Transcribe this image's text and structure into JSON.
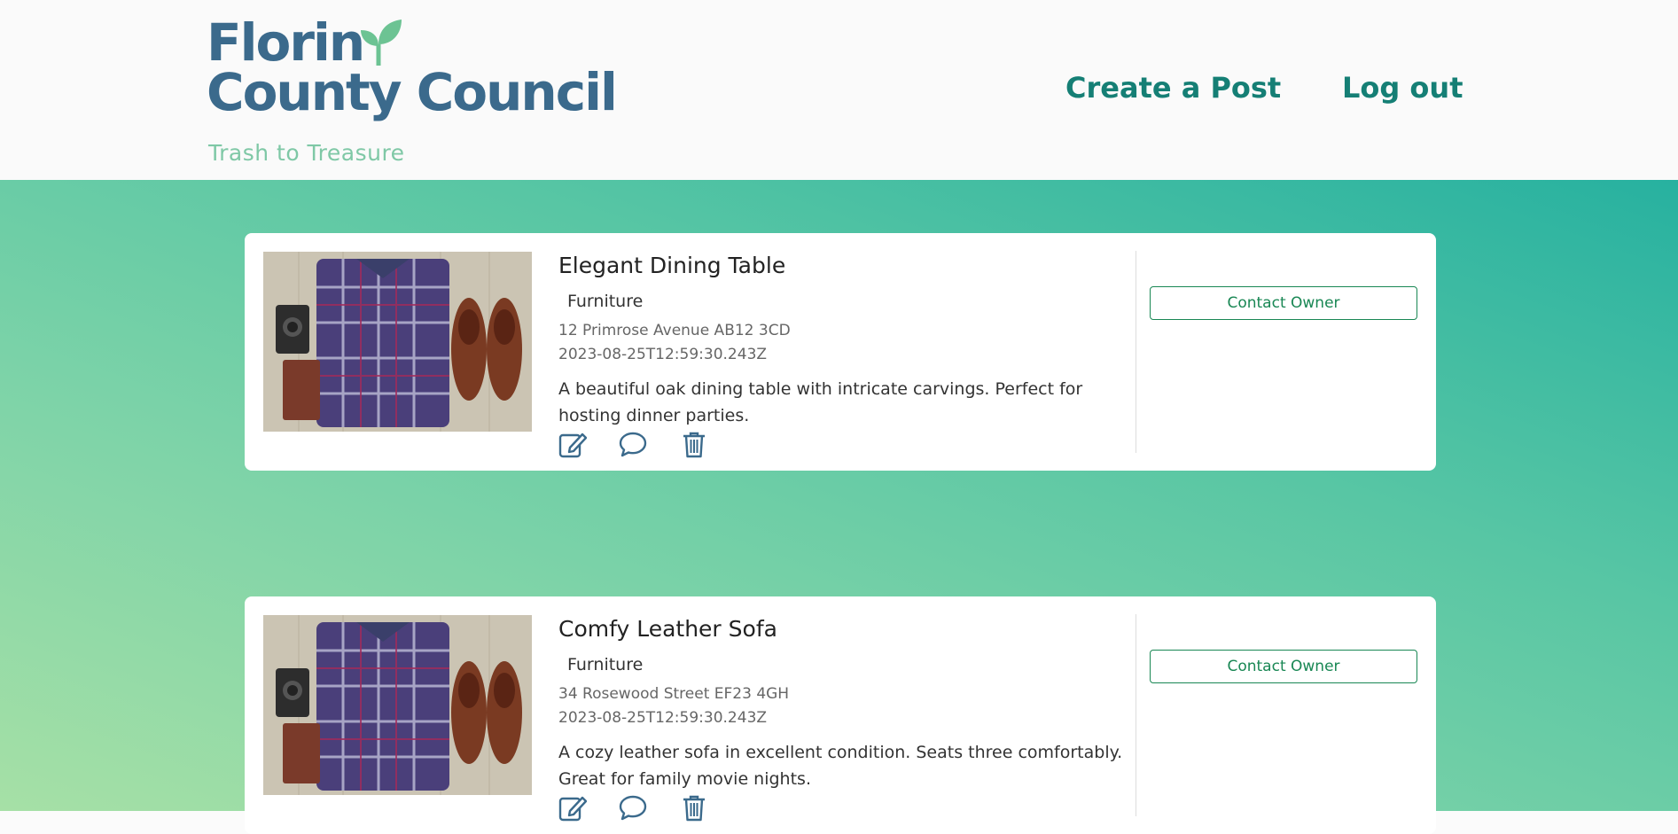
{
  "header": {
    "logo_line1": "Florin",
    "logo_line2": "County Council",
    "tagline": "Trash to Treasure",
    "nav": {
      "create_label": "Create a Post",
      "logout_label": "Log out"
    }
  },
  "colors": {
    "brand_blue": "#3b6a8c",
    "brand_green": "#7fc8a6",
    "nav_teal": "#157f75",
    "button_green": "#198754"
  },
  "posts": [
    {
      "title": "Elegant Dining Table",
      "category": "Furniture",
      "address": "12 Primrose Avenue AB12 3CD",
      "date": "2023-08-25T12:59:30.243Z",
      "description": "A beautiful oak dining table with intricate carvings. Perfect for hosting dinner parties.",
      "contact_label": "Contact Owner",
      "icons": [
        "edit-icon",
        "comment-icon",
        "trash-icon"
      ]
    },
    {
      "title": "Comfy Leather Sofa",
      "category": "Furniture",
      "address": "34 Rosewood Street EF23 4GH",
      "date": "2023-08-25T12:59:30.243Z",
      "description": "A cozy leather sofa in excellent condition. Seats three comfortably. Great for family movie nights.",
      "contact_label": "Contact Owner",
      "icons": [
        "edit-icon",
        "comment-icon",
        "trash-icon"
      ]
    }
  ]
}
